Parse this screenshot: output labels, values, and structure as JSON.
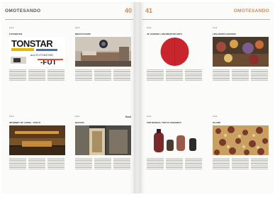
{
  "spread": {
    "left_header": "OMOTESANDO",
    "left_page_number": "40",
    "right_page_number": "41",
    "right_header": "OMOTESANDO"
  },
  "cards": [
    {
      "title": "FUTONSTAR",
      "logo": "",
      "headline": "FUTONSTAR and FUTON"
    },
    {
      "title": "BRICKS ROOM",
      "logo": ""
    },
    {
      "title": "JIL SANDER × NEUMEISTER ARTS",
      "logo": ""
    },
    {
      "title": "LIFE-BOOKS GRAPHIC",
      "logo": ""
    },
    {
      "title": "INTERNET OF LIVING · TOKYO",
      "logo": "Good"
    },
    {
      "title": "BANYAN",
      "logo": ""
    },
    {
      "title": "FOR DESIGN / TOKYO CERAMICS",
      "logo": ""
    },
    {
      "title": "ISLAND",
      "logo": ""
    }
  ],
  "colors": {
    "accent": "#c98a5a",
    "red_disc": "#c8252c",
    "background": "#fbfbf9"
  }
}
